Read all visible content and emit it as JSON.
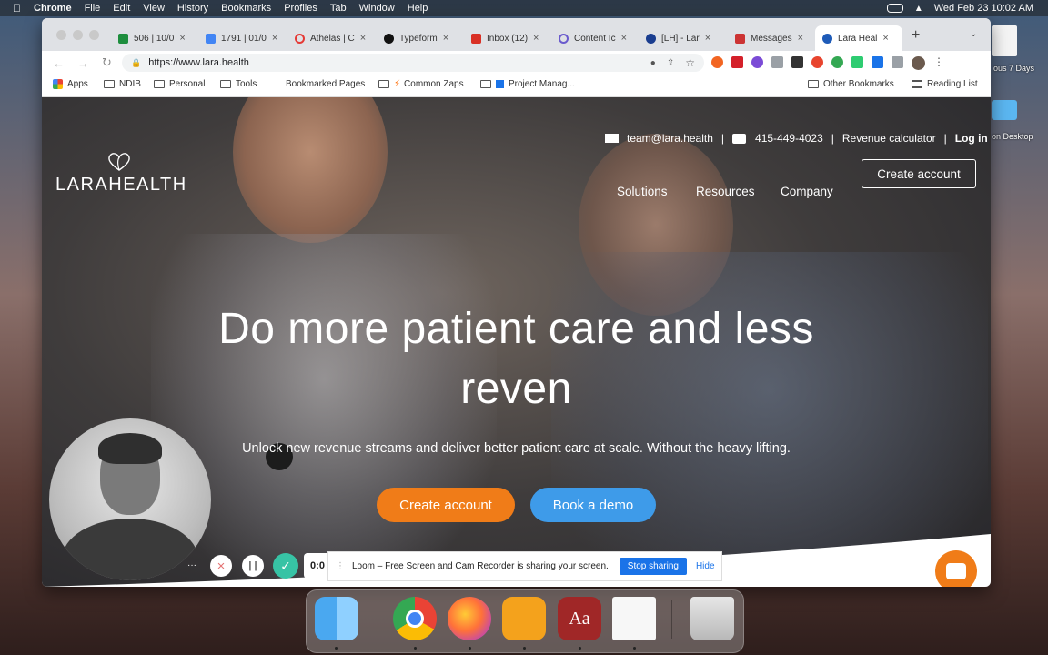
{
  "menubar": {
    "apple": "",
    "app": "Chrome",
    "items": [
      "File",
      "Edit",
      "View",
      "History",
      "Bookmarks",
      "Profiles",
      "Tab",
      "Window",
      "Help"
    ],
    "datetime": "Wed Feb 23  10:02 AM"
  },
  "desktop": {
    "label_previous": "ous 7 Days",
    "label_desktop": "on Desktop"
  },
  "browser": {
    "tabs": [
      {
        "label": "506 | 10/0",
        "color": "#1e8e3e"
      },
      {
        "label": "1791 | 01/0",
        "color": "#4285f4"
      },
      {
        "label": "Athelas | C",
        "color": "#e53935"
      },
      {
        "label": "Typeform",
        "color": "#111111"
      },
      {
        "label": "Inbox (12)",
        "color": "#d93025"
      },
      {
        "label": "Content Ic",
        "color": "#6a5acd"
      },
      {
        "label": "[LH] - Lar",
        "color": "#1a3d8f"
      },
      {
        "label": "Messages",
        "color": "#cc3333"
      },
      {
        "label": "Lara Heal",
        "color": "#1e5bb8"
      }
    ],
    "new_tab": "+",
    "url": "https://www.lara.health",
    "bookmarks": [
      {
        "label": "Apps",
        "type": "apps"
      },
      {
        "label": "NDIB",
        "type": "folder"
      },
      {
        "label": "Personal",
        "type": "folder"
      },
      {
        "label": "Tools",
        "type": "folder"
      },
      {
        "label": "Bookmarked Pages",
        "type": "folder"
      },
      {
        "label": "Common Zaps",
        "type": "zap"
      },
      {
        "label": "Project Manag...",
        "type": "doc"
      }
    ],
    "other_bookmarks": "Other Bookmarks",
    "reading_list": "Reading List"
  },
  "site": {
    "logo_word1": "LARA",
    "logo_word2": "HEALTH",
    "email": "team@lara.health",
    "phone": "415-449-4023",
    "revenue_calculator": "Revenue calculator",
    "login": "Log in",
    "nav": [
      "Solutions",
      "Resources",
      "Company"
    ],
    "create_account_nav": "Create account",
    "hero_line1": "Do more patient care and less",
    "hero_line2": "reven",
    "subtitle": "Unlock new revenue streams and deliver better patient care at scale. Without the heavy lifting.",
    "cta_primary": "Create account",
    "cta_secondary": "Book a demo",
    "colors": {
      "primary": "#f07c18",
      "secondary": "#3e9be9"
    }
  },
  "loom": {
    "timer": "0:0",
    "message": "Loom – Free Screen and Cam Recorder is sharing your screen.",
    "stop_sharing": "Stop sharing",
    "hide": "Hide",
    "more": "···"
  },
  "dock": {
    "apps": [
      "finder",
      "chrome",
      "firefox",
      "taskheat",
      "dictionary",
      "textedit",
      "trash"
    ]
  }
}
